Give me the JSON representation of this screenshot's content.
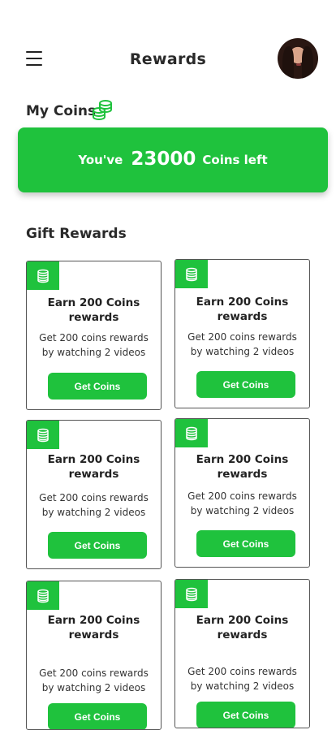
{
  "header": {
    "title": "Rewards",
    "menu_icon": "hamburger-menu-icon",
    "avatar": "user-avatar"
  },
  "my_coins": {
    "heading": "My Coins",
    "icon": "coins-stack-icon",
    "banner": {
      "prefix": "You've",
      "amount": "23000",
      "suffix": "Coins left"
    }
  },
  "gift_rewards": {
    "heading": "Gift Rewards",
    "cards": [
      {
        "title": "Earn 200 Coins rewards",
        "desc_line1": "Get 200 coins rewards",
        "desc_line2": "by watching 2 videos",
        "button": "Get Coins"
      },
      {
        "title": "Earn 200 Coins rewards",
        "desc_line1": "Get 200 coins rewards",
        "desc_line2": "by watching 2 videos",
        "button": "Get Coins"
      },
      {
        "title": "Earn 200 Coins rewards",
        "desc_line1": "Get 200 coins rewards",
        "desc_line2": "by watching 2 videos",
        "button": "Get Coins"
      },
      {
        "title": "Earn 200 Coins rewards",
        "desc_line1": "Get 200 coins rewards",
        "desc_line2": "by watching 2 videos",
        "button": "Get Coins"
      },
      {
        "title": "Earn 200 Coins rewards",
        "desc_line1": "Get 200 coins rewards",
        "desc_line2": "by watching 2 videos",
        "button": "Get Coins"
      },
      {
        "title": "Earn 200 Coins rewards",
        "desc_line1": "Get 200 coins rewards",
        "desc_line2": "by watching 2 videos",
        "button": "Get Coins"
      }
    ]
  },
  "colors": {
    "accent": "#1fc23d",
    "text": "#222222",
    "card_border": "#555555"
  }
}
